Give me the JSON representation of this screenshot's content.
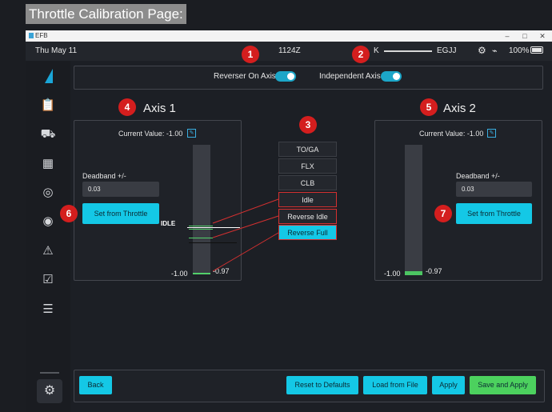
{
  "caption": "Throttle Calibration Page:",
  "window": {
    "title": "EFB",
    "controls": [
      "–",
      "□",
      "✕"
    ]
  },
  "status": {
    "date": "Thu May 11",
    "time": "1124Z",
    "route_from": "K",
    "route_to": "EGJJ",
    "battery": "100%"
  },
  "toggles": {
    "reverser_on_axis": {
      "label": "Reverser On Axis",
      "on": true
    },
    "independent_axis": {
      "label": "Independent Axis",
      "on": true
    }
  },
  "axis1": {
    "title": "Axis 1",
    "current_value": "Current Value: -1.00",
    "deadband_label": "Deadband +/-",
    "deadband_value": "0.03",
    "set_button": "Set from Throttle",
    "min_label": "-1.00",
    "marker_label": "-0.97",
    "idle_label": "IDLE"
  },
  "axis2": {
    "title": "Axis 2",
    "current_value": "Current Value: -1.00",
    "deadband_label": "Deadband +/-",
    "deadband_value": "0.03",
    "set_button": "Set from Throttle",
    "min_label": "-1.00",
    "marker_label": "-0.97"
  },
  "detents": [
    "TO/GA",
    "FLX",
    "CLB",
    "Idle",
    "Reverse Idle",
    "Reverse Full"
  ],
  "selected_detent": "Reverse Full",
  "badges": [
    "1",
    "2",
    "3",
    "4",
    "5",
    "6",
    "7"
  ],
  "bottom": {
    "back": "Back",
    "reset": "Reset to Defaults",
    "load": "Load from File",
    "apply": "Apply",
    "save_apply": "Save and Apply"
  },
  "colors": {
    "accent": "#14c8e6",
    "save": "#4cd15e",
    "annotation": "#d41e1e",
    "marker": "#52d06a"
  }
}
